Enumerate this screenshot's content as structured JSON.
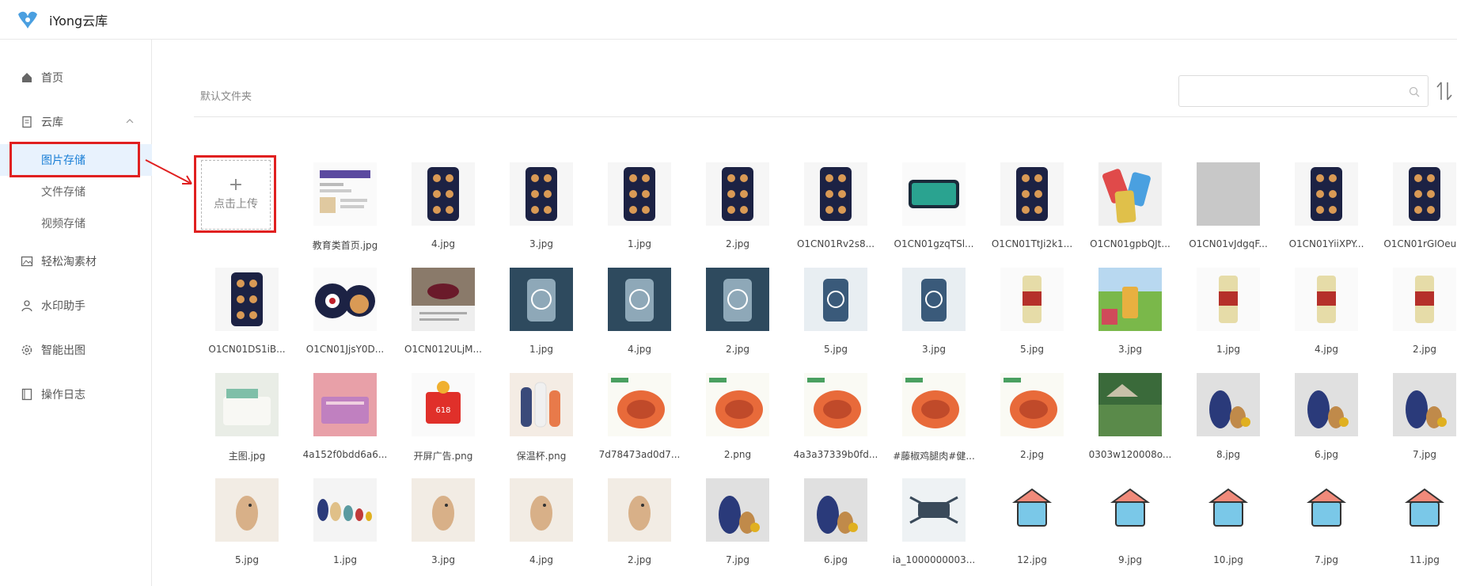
{
  "app": {
    "title": "iYong云库"
  },
  "sidebar": {
    "items": [
      {
        "label": "首页",
        "icon": "home-icon"
      },
      {
        "label": "云库",
        "icon": "document-icon",
        "expanded": true
      },
      {
        "label": "轻松淘素材",
        "icon": "image-icon"
      },
      {
        "label": "水印助手",
        "icon": "user-icon"
      },
      {
        "label": "智能出图",
        "icon": "gear-icon"
      },
      {
        "label": "操作日志",
        "icon": "log-icon"
      }
    ],
    "sub_items": [
      {
        "label": "图片存储",
        "active": true
      },
      {
        "label": "文件存储",
        "active": false
      },
      {
        "label": "视频存储",
        "active": false
      }
    ]
  },
  "breadcrumb": "默认文件夹",
  "search": {
    "placeholder": ""
  },
  "upload": {
    "label": "点击上传"
  },
  "files": [
    [
      {
        "name": "教育类首页.jpg",
        "kind": "doc"
      },
      {
        "name": "4.jpg",
        "kind": "phone"
      },
      {
        "name": "3.jpg",
        "kind": "phone"
      },
      {
        "name": "1.jpg",
        "kind": "phone"
      },
      {
        "name": "2.jpg",
        "kind": "phone"
      },
      {
        "name": "O1CN01Rv2s8...",
        "kind": "phone"
      },
      {
        "name": "O1CN01gzqTSl...",
        "kind": "phone2"
      },
      {
        "name": "O1CN01TtJi2k1...",
        "kind": "phone"
      },
      {
        "name": "O1CN01gpbQJt...",
        "kind": "colorful"
      },
      {
        "name": "O1CN01vJdgqF...",
        "kind": "gray"
      },
      {
        "name": "O1CN01YiiXPY...",
        "kind": "phone"
      },
      {
        "name": "O1CN01rGIOeu...",
        "kind": "phone"
      }
    ],
    [
      {
        "name": "O1CN01DS1iB...",
        "kind": "phone"
      },
      {
        "name": "O1CN01JjsY0D...",
        "kind": "bear"
      },
      {
        "name": "O1CN012ULjM...",
        "kind": "cherry"
      },
      {
        "name": "1.jpg",
        "kind": "tech"
      },
      {
        "name": "4.jpg",
        "kind": "tech"
      },
      {
        "name": "2.jpg",
        "kind": "tech"
      },
      {
        "name": "5.jpg",
        "kind": "techlight"
      },
      {
        "name": "3.jpg",
        "kind": "techlight"
      },
      {
        "name": "5.jpg",
        "kind": "beer"
      },
      {
        "name": "3.jpg",
        "kind": "beerfield"
      },
      {
        "name": "1.jpg",
        "kind": "beer"
      },
      {
        "name": "4.jpg",
        "kind": "beer"
      },
      {
        "name": "2.jpg",
        "kind": "beer"
      }
    ],
    [
      {
        "name": "主图.jpg",
        "kind": "pale"
      },
      {
        "name": "4a152f0bdd6a6...",
        "kind": "pink"
      },
      {
        "name": "开屏广告.png",
        "kind": "red"
      },
      {
        "name": "保温杯.png",
        "kind": "bottle"
      },
      {
        "name": "7d78473ad0d7...",
        "kind": "food"
      },
      {
        "name": "2.png",
        "kind": "food"
      },
      {
        "name": "4a3a37339b0fd...",
        "kind": "food"
      },
      {
        "name": "#藤椒鸡腿肉#健...",
        "kind": "food"
      },
      {
        "name": "2.jpg",
        "kind": "food"
      },
      {
        "name": "0303w120008o...",
        "kind": "green"
      },
      {
        "name": "8.jpg",
        "kind": "toy"
      },
      {
        "name": "6.jpg",
        "kind": "toy"
      },
      {
        "name": "7.jpg",
        "kind": "toy"
      }
    ],
    [
      {
        "name": "5.jpg",
        "kind": "wood"
      },
      {
        "name": "1.jpg",
        "kind": "toyrow"
      },
      {
        "name": "3.jpg",
        "kind": "wood"
      },
      {
        "name": "4.jpg",
        "kind": "wood"
      },
      {
        "name": "2.jpg",
        "kind": "wood"
      },
      {
        "name": "7.jpg",
        "kind": "toy"
      },
      {
        "name": "6.jpg",
        "kind": "toy"
      },
      {
        "name": "ia_1000000003...",
        "kind": "drone"
      },
      {
        "name": "12.jpg",
        "kind": "icon"
      },
      {
        "name": "9.jpg",
        "kind": "icon"
      },
      {
        "name": "10.jpg",
        "kind": "icon"
      },
      {
        "name": "7.jpg",
        "kind": "icon"
      },
      {
        "name": "11.jpg",
        "kind": "icon"
      }
    ]
  ],
  "colors": {
    "accent": "#1a7fd6",
    "annotation": "#e02020",
    "active_bg": "#e8f2fd"
  }
}
